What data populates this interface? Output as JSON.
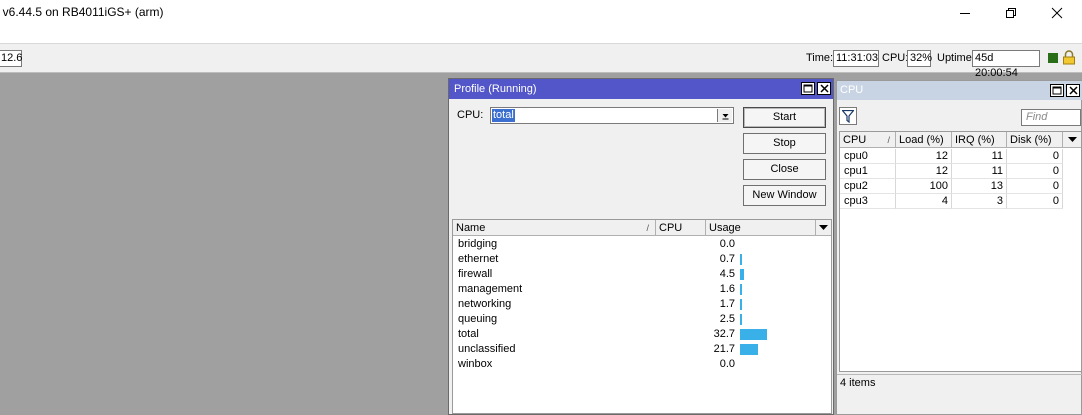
{
  "window": {
    "title": ": v6.44.5 on RB4011iGS+ (arm)"
  },
  "statusbar": {
    "left_value": "12.6",
    "time_label": "Time:",
    "time_value": "11:31:03",
    "cpu_label": "CPU:",
    "cpu_value": "32%",
    "uptime_label": "Uptime:",
    "uptime_value": "45d 20:00:54",
    "indicator_color": "#2a6e1a"
  },
  "profile_window": {
    "title": "Profile (Running)",
    "cpu_label": "CPU:",
    "cpu_selected": "total",
    "buttons": {
      "start": "Start",
      "stop": "Stop",
      "close": "Close",
      "new_window": "New Window"
    },
    "columns": [
      "Name",
      "CPU",
      "Usage"
    ],
    "bar_color": "#3ab0e8",
    "rows": [
      {
        "name": "bridging",
        "usage": "0.0",
        "percent": 0.0
      },
      {
        "name": "ethernet",
        "usage": "0.7",
        "percent": 0.7
      },
      {
        "name": "firewall",
        "usage": "4.5",
        "percent": 4.5
      },
      {
        "name": "management",
        "usage": "1.6",
        "percent": 1.6
      },
      {
        "name": "networking",
        "usage": "1.7",
        "percent": 1.7
      },
      {
        "name": "queuing",
        "usage": "2.5",
        "percent": 2.5
      },
      {
        "name": "total",
        "usage": "32.7",
        "percent": 32.7
      },
      {
        "name": "unclassified",
        "usage": "21.7",
        "percent": 21.7
      },
      {
        "name": "winbox",
        "usage": "0.0",
        "percent": 0.0
      }
    ]
  },
  "cpu_window": {
    "title": "CPU",
    "find_placeholder": "Find",
    "columns": [
      "CPU",
      "Load (%)",
      "IRQ (%)",
      "Disk (%)"
    ],
    "rows": [
      {
        "cpu": "cpu0",
        "load": "12",
        "irq": "11",
        "disk": "0"
      },
      {
        "cpu": "cpu1",
        "load": "12",
        "irq": "11",
        "disk": "0"
      },
      {
        "cpu": "cpu2",
        "load": "100",
        "irq": "13",
        "disk": "0"
      },
      {
        "cpu": "cpu3",
        "load": "4",
        "irq": "3",
        "disk": "0"
      }
    ],
    "items_count": "4 items"
  }
}
